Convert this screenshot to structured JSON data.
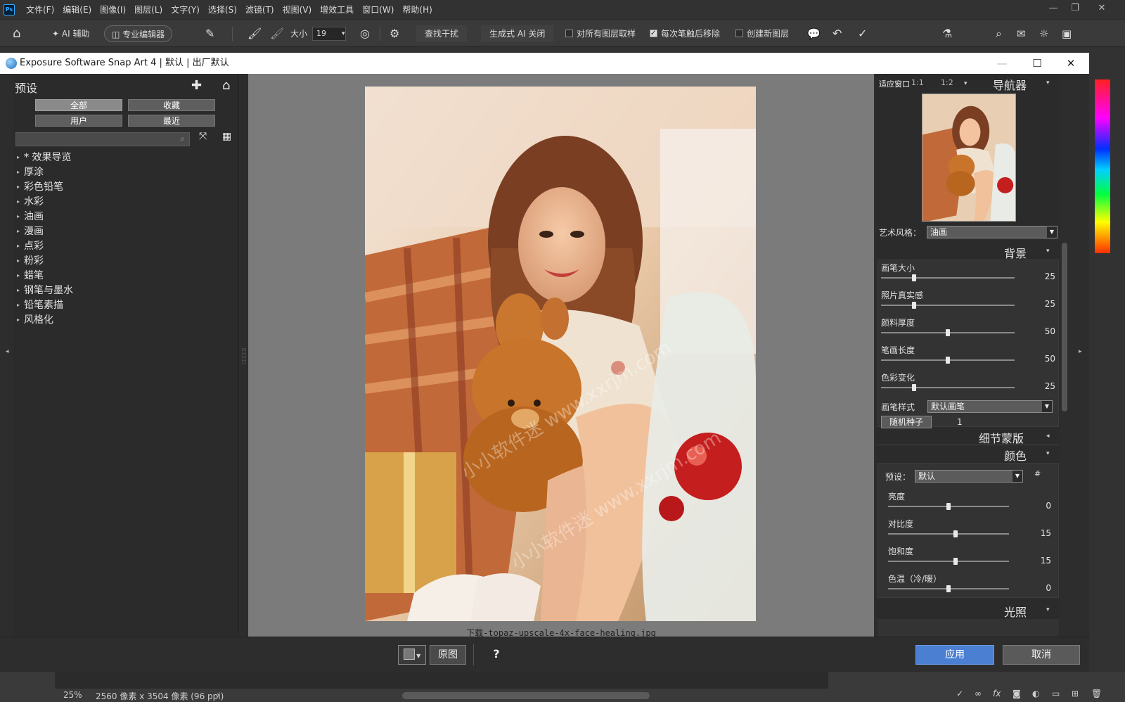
{
  "ps_menu": {
    "items": [
      "文件(F)",
      "编辑(E)",
      "图像(I)",
      "图层(L)",
      "文字(Y)",
      "选择(S)",
      "滤镜(T)",
      "视图(V)",
      "增效工具",
      "窗口(W)",
      "帮助(H)"
    ]
  },
  "ps_options": {
    "ai_assist": "AI 辅助",
    "pro_editor": "专业编辑器",
    "size_label": "大小",
    "size_value": "19",
    "find_distract": "查找干扰",
    "gen_ai": "生成式 AI 关闭",
    "sample_all_layers": "对所有图层取样",
    "remove_after_stroke": "每次笔触后移除",
    "create_new_layer": "创建新图层"
  },
  "dialog": {
    "title": "Exposure Software Snap Art 4 | 默认 | 出厂默认",
    "apply": "应用",
    "cancel": "取消",
    "original": "原图",
    "help": "?"
  },
  "presets": {
    "title": "预设",
    "filters": [
      "全部",
      "收藏",
      "用户",
      "最近"
    ],
    "tree": [
      "* 效果导览",
      "厚涂",
      "彩色铅笔",
      "水彩",
      "油画",
      "漫画",
      "点彩",
      "粉彩",
      "蜡笔",
      "钢笔与墨水",
      "铅笔素描",
      "风格化"
    ]
  },
  "canvas": {
    "filename": "下载-topaz-upscale-4x-face-healing.jpg",
    "watermark": "小小软件迷 www.xxrjm.com"
  },
  "navigator": {
    "fit_label": "适应窗口",
    "zoom_1": "1:1",
    "zoom_2": "1:2",
    "title": "导航器",
    "art_style_label": "艺术风格：",
    "art_style_value": "油画"
  },
  "background": {
    "title": "背景",
    "sliders": [
      {
        "label": "画笔大小",
        "value": "25",
        "pos": 0.25
      },
      {
        "label": "照片真实感",
        "value": "25",
        "pos": 0.25
      },
      {
        "label": "颜料厚度",
        "value": "50",
        "pos": 0.5
      },
      {
        "label": "笔画长度",
        "value": "50",
        "pos": 0.5
      },
      {
        "label": "色彩变化",
        "value": "25",
        "pos": 0.25
      }
    ],
    "brush_style_label": "画笔样式",
    "brush_style_value": "默认画笔",
    "random_seed_label": "随机种子",
    "random_seed_value": "1"
  },
  "detail_mask": {
    "title": "细节蒙版"
  },
  "color": {
    "title": "颜色",
    "preset_label": "预设：",
    "preset_value": "默认",
    "sliders": [
      {
        "label": "亮度",
        "value": "0",
        "pos": 0.5
      },
      {
        "label": "对比度",
        "value": "15",
        "pos": 0.56
      },
      {
        "label": "饱和度",
        "value": "15",
        "pos": 0.56
      },
      {
        "label": "色温（冷/暖）",
        "value": "0",
        "pos": 0.5
      }
    ]
  },
  "lighting": {
    "title": "光照"
  },
  "status": {
    "zoom": "25%",
    "doc_size": "2560 像素 x 3504 像素 (96 ppi)"
  },
  "colors": {
    "apply_blue": "#4a7fd1",
    "ps_blue": "#31a8ff"
  }
}
